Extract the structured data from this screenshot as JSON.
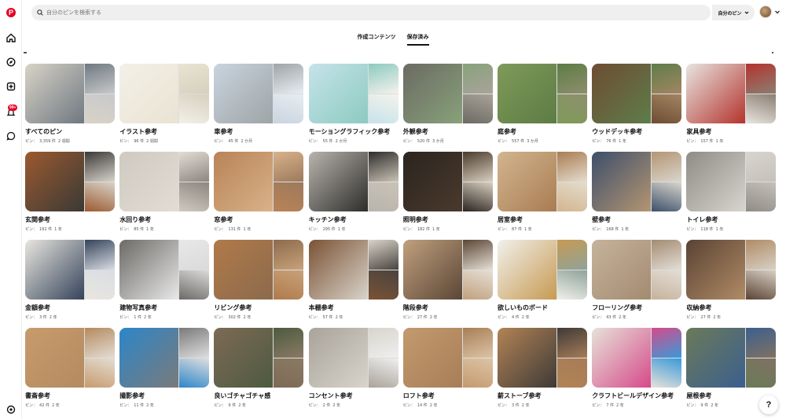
{
  "rail": {
    "logo_letter": "P",
    "notification_count": "99+",
    "items": [
      "home-icon",
      "explore-icon",
      "create-icon",
      "notifications-icon",
      "messages-icon",
      "settings-icon"
    ]
  },
  "search": {
    "placeholder": "自分のピンを検索する"
  },
  "filter": {
    "label": "自分のピン"
  },
  "tabs": {
    "created": "作成コンテンツ",
    "saved": "保存済み"
  },
  "pin_label": "ピン：",
  "boards": [
    {
      "name": "すべてのピン",
      "count": "3,359 件",
      "age": "2 週間",
      "colors": [
        "#d8d3c7",
        "#6f7880",
        "#c7c9cb"
      ]
    },
    {
      "name": "イラスト参考",
      "count": "96 件",
      "age": "2 週間",
      "colors": [
        "#f3f0e8",
        "#e9e3d2",
        "#d6d0be"
      ]
    },
    {
      "name": "車参考",
      "count": "45 件",
      "age": "2 か月",
      "colors": [
        "#c9d4df",
        "#9ea4a6",
        "#e7edf2"
      ]
    },
    {
      "name": "モーショングラフィック参考",
      "count": "55 件",
      "age": "2 か月",
      "colors": [
        "#c6e3ea",
        "#8ccac0",
        "#f5f2ec"
      ]
    },
    {
      "name": "外観参考",
      "count": "520 件",
      "age": "3 か月",
      "colors": [
        "#6b6a63",
        "#88a27a",
        "#a9a39a"
      ]
    },
    {
      "name": "庭参考",
      "count": "557 件",
      "age": "3 か月",
      "colors": [
        "#7f9a59",
        "#5d7c45",
        "#8d8f6d"
      ]
    },
    {
      "name": "ウッドデッキ参考",
      "count": "76 件",
      "age": "1 年",
      "colors": [
        "#6e4c33",
        "#5e7d4a",
        "#a38562"
      ]
    },
    {
      "name": "家具参考",
      "count": "157 件",
      "age": "1 年",
      "colors": [
        "#e8e5e0",
        "#b4332e",
        "#8c7e72"
      ]
    },
    {
      "name": "玄関参考",
      "count": "162 件",
      "age": "1 年",
      "colors": [
        "#9b5a2f",
        "#3a3936",
        "#d8d3ca"
      ]
    },
    {
      "name": "水回り参考",
      "count": "85 件",
      "age": "1 年",
      "colors": [
        "#cfcac1",
        "#e2ddd4",
        "#8c8680"
      ]
    },
    {
      "name": "窓参考",
      "count": "131 件",
      "age": "1 年",
      "colors": [
        "#b98357",
        "#d8b28a",
        "#9c7a5c"
      ]
    },
    {
      "name": "キッチン参考",
      "count": "295 件",
      "age": "1 年",
      "colors": [
        "#b8b4ad",
        "#2e2d2b",
        "#c9c2b6"
      ]
    },
    {
      "name": "照明参考",
      "count": "182 件",
      "age": "1 年",
      "colors": [
        "#2b2420",
        "#4a3a2c",
        "#d9cfbf"
      ]
    },
    {
      "name": "居室参考",
      "count": "87 件",
      "age": "1 年",
      "colors": [
        "#d2b58f",
        "#a97c52",
        "#e4dccd"
      ]
    },
    {
      "name": "壁参考",
      "count": "168 件",
      "age": "1 年",
      "colors": [
        "#3c4f6a",
        "#b49572",
        "#d9d5cd"
      ]
    },
    {
      "name": "トイレ参考",
      "count": "118 件",
      "age": "1 年",
      "colors": [
        "#8f8c86",
        "#d8d5cf",
        "#c5c1b9"
      ]
    },
    {
      "name": "金額参考",
      "count": "3 件",
      "age": "2 年",
      "colors": [
        "#e9e6df",
        "#34435a",
        "#d9dde3"
      ]
    },
    {
      "name": "建物写真参考",
      "count": "1 件",
      "age": "2 年",
      "colors": [
        "#6c6a66",
        "#e8e8e8",
        "#dadada"
      ]
    },
    {
      "name": "リビング参考",
      "count": "302 件",
      "age": "2 年",
      "colors": [
        "#b07a4a",
        "#8c6a4c",
        "#c7a27a"
      ]
    },
    {
      "name": "本棚参考",
      "count": "57 件",
      "age": "2 年",
      "colors": [
        "#7a5234",
        "#d9d4ca",
        "#4a4440"
      ]
    },
    {
      "name": "階段参考",
      "count": "27 件",
      "age": "2 年",
      "colors": [
        "#c0a07e",
        "#5b4636",
        "#e5dfd4"
      ]
    },
    {
      "name": "欲しいものボード",
      "count": "4 件",
      "age": "2 年",
      "colors": [
        "#f1f0ec",
        "#c79a52",
        "#8fa39a"
      ]
    },
    {
      "name": "フローリング参考",
      "count": "43 件",
      "age": "2 年",
      "colors": [
        "#c6b29b",
        "#a38b71",
        "#e3ded6"
      ]
    },
    {
      "name": "収納参考",
      "count": "27 件",
      "age": "2 年",
      "colors": [
        "#5a4334",
        "#b08b66",
        "#d7d0c4"
      ]
    },
    {
      "name": "書斎参考",
      "count": "42 件",
      "age": "2 年",
      "colors": [
        "#c79b6c",
        "#b48a60",
        "#e3ddd2"
      ]
    },
    {
      "name": "撮影参考",
      "count": "11 件",
      "age": "2 年",
      "colors": [
        "#2c86c9",
        "#7a7a7a",
        "#dedede"
      ]
    },
    {
      "name": "良いゴチャゴチャ感",
      "count": "9 件",
      "age": "2 年",
      "colors": [
        "#7d6a55",
        "#4d5a40",
        "#8a7a64"
      ]
    },
    {
      "name": "コンセント参考",
      "count": "2 件",
      "age": "2 年",
      "colors": [
        "#a9a39a",
        "#d8d4cc",
        "#efefef"
      ]
    },
    {
      "name": "ロフト参考",
      "count": "14 件",
      "age": "2 年",
      "colors": [
        "#c39a6e",
        "#a77e57",
        "#dcc4a5"
      ]
    },
    {
      "name": "薪ストーブ参考",
      "count": "3 件",
      "age": "2 年",
      "colors": [
        "#b28355",
        "#3e3a37",
        "#a67c58"
      ]
    },
    {
      "name": "クラフトビールデザイン参考",
      "count": "7 件",
      "age": "2 年",
      "colors": [
        "#e7e2d9",
        "#d64a8a",
        "#3a9ad9"
      ]
    },
    {
      "name": "屋根参考",
      "count": "9 件",
      "age": "2 年",
      "colors": [
        "#6b7a58",
        "#3b5f8f",
        "#7f7262"
      ]
    }
  ],
  "help_label": "?"
}
